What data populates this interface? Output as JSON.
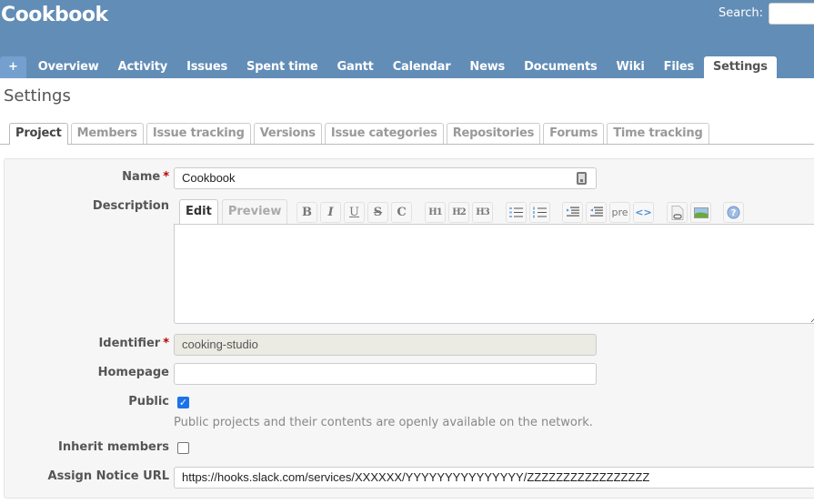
{
  "header": {
    "project_title": "Cookbook",
    "search_label": "Search:",
    "search_value": ""
  },
  "main_menu": {
    "new_label": "+",
    "items": [
      "Overview",
      "Activity",
      "Issues",
      "Spent time",
      "Gantt",
      "Calendar",
      "News",
      "Documents",
      "Wiki",
      "Files",
      "Settings"
    ],
    "selected": "Settings"
  },
  "page": {
    "heading": "Settings"
  },
  "settings_tabs": {
    "items": [
      "Project",
      "Members",
      "Issue tracking",
      "Versions",
      "Issue categories",
      "Repositories",
      "Forums",
      "Time tracking"
    ],
    "selected": "Project"
  },
  "form": {
    "required_marker": "*",
    "name": {
      "label": "Name",
      "value": "Cookbook"
    },
    "description": {
      "label": "Description",
      "tabs": [
        "Edit",
        "Preview"
      ],
      "selected_tab": "Edit",
      "toolbar": {
        "bold": "B",
        "italic": "I",
        "underline": "U",
        "strike": "S",
        "code": "C",
        "h1": "H1",
        "h2": "H2",
        "h3": "H3",
        "ul": "unordered-list",
        "ol": "ordered-list",
        "indent": "indent",
        "outdent": "outdent",
        "pre": "pre",
        "code_block": "<>",
        "link": "link",
        "image": "image",
        "help": "?"
      },
      "value": ""
    },
    "identifier": {
      "label": "Identifier",
      "value": "cooking-studio"
    },
    "homepage": {
      "label": "Homepage",
      "value": ""
    },
    "public": {
      "label": "Public",
      "checked": true,
      "info": "Public projects and their contents are openly available on the network."
    },
    "inherit_members": {
      "label": "Inherit members",
      "checked": false
    },
    "assign_notice_url": {
      "label": "Assign Notice URL",
      "value": "https://hooks.slack.com/services/XXXXXX/YYYYYYYYYYYYYYY/ZZZZZZZZZZZZZZZZZ"
    }
  }
}
